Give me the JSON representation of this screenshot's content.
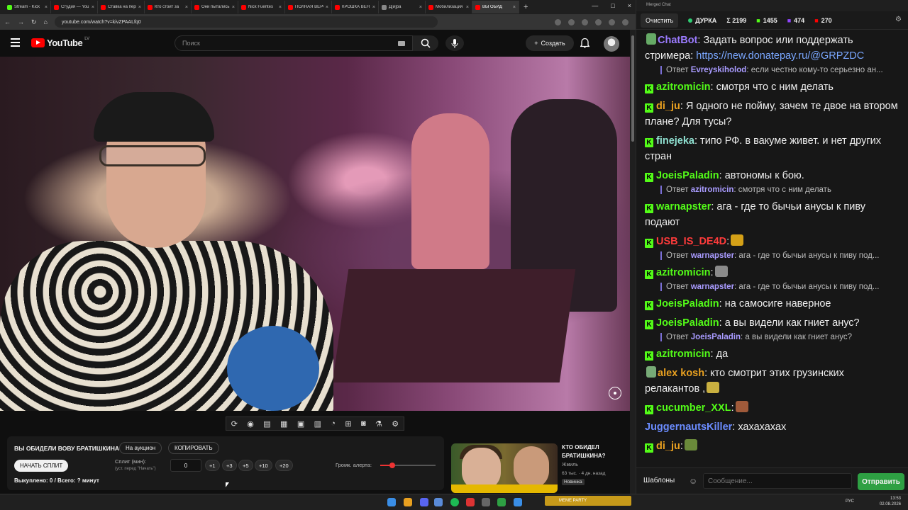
{
  "browser": {
    "tabs": [
      {
        "title": "Stream - Kick",
        "color": "#53fc18"
      },
      {
        "title": "Студия — YouTube",
        "color": "#f00"
      },
      {
        "title": "Ставка на первые",
        "color": "#f00"
      },
      {
        "title": "Кто стоит за",
        "color": "#f00"
      },
      {
        "title": "Они пытались",
        "color": "#f00"
      },
      {
        "title": "Nick Fuentes",
        "color": "#f00"
      },
      {
        "title": "ПОЛНАЯ ВЕРСИЯ",
        "color": "#f00"
      },
      {
        "title": "КРОШКА ВЕН",
        "color": "#f00"
      },
      {
        "title": "Д[и]ра",
        "color": "#888"
      },
      {
        "title": "Мобилизация",
        "color": "#f00"
      },
      {
        "title": "ВЫ ОБИД",
        "color": "#f00"
      }
    ],
    "url": "youtube.com/watch?v=kivZPAALfq0"
  },
  "youtube": {
    "logo": "YouTube",
    "country": "LV",
    "search_placeholder": "Поиск",
    "create_label": "Создать"
  },
  "panel": {
    "title": "ВЫ ОБИДЕЛИ ВОВУ БРАТИШКИНА",
    "auction_label": "На аукцион",
    "copy_label": "КОПИРОВАТЬ",
    "start_label": "НАЧАТЬ СПЛИТ",
    "split_label": "Сплит (мин):",
    "split_hint": "(уст. перед \"Начать\")",
    "split_value": "0",
    "increments": [
      "+1",
      "+3",
      "+5",
      "+10",
      "+20"
    ],
    "volume_label": "Громк. алерта:",
    "volume_level": 0.22,
    "bought": "Выкуплено: 0 / Всего: ? минут"
  },
  "recommendation": {
    "title": "КТО ОБИДЕЛ БРАТИШКИНА?",
    "channel": "Жмиль",
    "meta": "63 тыс. · 4 дн. назад",
    "badge": "Новинка"
  },
  "chat": {
    "window_title": "Merged Chat",
    "clear_label": "Очистить",
    "streamer": "ДУРКА",
    "total": "Σ 2199",
    "kick_count": "1455",
    "twitch_count": "474",
    "yt_count": "270",
    "templates_label": "Шаблоны",
    "input_placeholder": "Сообщение...",
    "send_label": "Отправить",
    "messages": [
      {
        "user": "ChatBot",
        "color": "#9b7bff",
        "text": ": Задать вопрос или поддержать стримера: ",
        "link": "https://new.donatepay.ru/@GRPZDC"
      },
      {
        "reply_prefix": "Ответ",
        "reply_user": "Evreyskiholod",
        "reply_text": ": если честно кому-то серьезно ан..."
      },
      {
        "user": "azitromicin",
        "color": "#53fc18",
        "text": ": смотря что с ним делать"
      },
      {
        "user": "di_ju",
        "color": "#e8a020",
        "text": ": Я одного не пойму, зачем те двое на втором плане?  Для тусы?"
      },
      {
        "user": "finejeka",
        "color": "#8fe0d0",
        "text": ": типо РФ. в вакуме живет. и нет других стран"
      },
      {
        "user": "JoeisPaladin",
        "color": "#53fc18",
        "text": ": автономы к бою."
      },
      {
        "reply_prefix": "Ответ",
        "reply_user": "azitromicin",
        "reply_text": ": смотря что с ним делать"
      },
      {
        "user": "warnapster",
        "color": "#53fc18",
        "text": ": ага - где то бычьи анусы к пиву подают"
      },
      {
        "user": "USB_IS_DE4D",
        "color": "#ff3b3b",
        "text": ":"
      },
      {
        "reply_prefix": "Ответ",
        "reply_user": "warnapster",
        "reply_text": ": ага - где то бычьи анусы к пиву под..."
      },
      {
        "user": "azitromicin",
        "color": "#53fc18",
        "text": ":"
      },
      {
        "reply_prefix": "Ответ",
        "reply_user": "warnapster",
        "reply_text": ": ага - где то бычьи анусы к пиву под..."
      },
      {
        "user": "JoeisPaladin",
        "color": "#53fc18",
        "text": ": на самосиге наверное"
      },
      {
        "user": "JoeisPaladin",
        "color": "#53fc18",
        "text": ": а вы видели как гниет анус?"
      },
      {
        "reply_prefix": "Ответ",
        "reply_user": "JoeisPaladin",
        "reply_text": ": а вы видели как гниет анус?"
      },
      {
        "user": "azitromicin",
        "color": "#53fc18",
        "text": ": да"
      },
      {
        "user": "alex kosh",
        "color": "#e8a020",
        "text": ": кто смотрит этих грузинских релакантов ,"
      },
      {
        "user": "cucumber_XXL",
        "color": "#53fc18",
        "text": ":"
      },
      {
        "user": "JuggernautsKiller",
        "color": "#6b8cff",
        "text": ": хахахахах"
      },
      {
        "user": "di_ju",
        "color": "#e8a020",
        "text": ":"
      }
    ]
  },
  "taskbar": {
    "active_label": "MEME PARTY",
    "time": "13:53",
    "date": "02.08.2026",
    "lang": "РУС"
  }
}
